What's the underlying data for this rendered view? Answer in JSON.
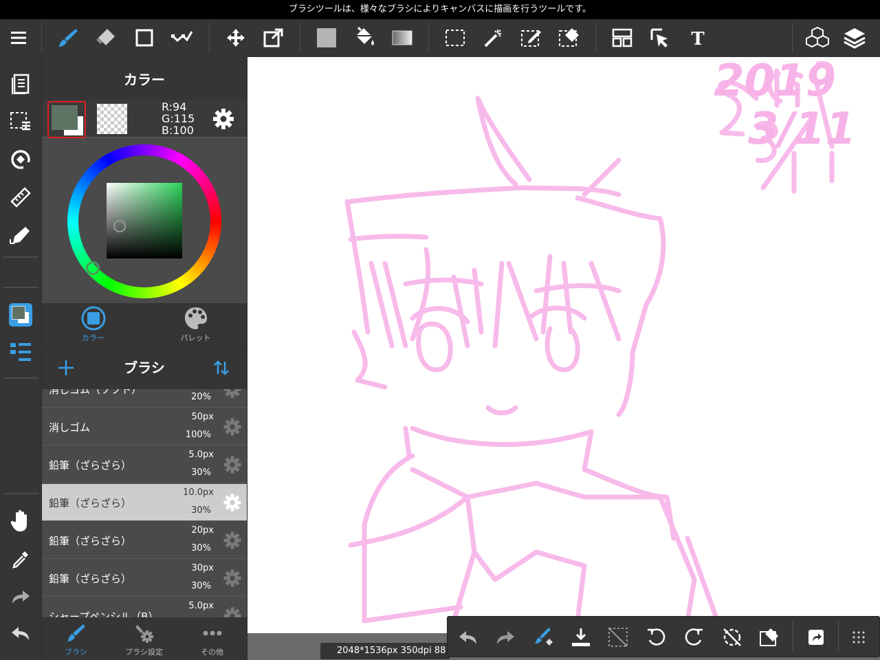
{
  "statusbar": {
    "tooltip": "ブラシツールは、様々なブラシによりキャンバスに描画を行うツールです。"
  },
  "toolbar": {
    "tools": [
      {
        "name": "menu-icon"
      },
      {
        "name": "brush-tool-icon",
        "active": true
      },
      {
        "name": "eraser-tool-icon"
      },
      {
        "name": "rectangle-tool-icon"
      },
      {
        "name": "vector-tool-icon"
      },
      {
        "name": "move-tool-icon"
      },
      {
        "name": "transform-tool-icon"
      },
      {
        "name": "fill-color-icon"
      },
      {
        "name": "bucket-tool-icon"
      },
      {
        "name": "gradient-tool-icon"
      },
      {
        "name": "select-rect-icon"
      },
      {
        "name": "magic-wand-icon"
      },
      {
        "name": "select-pen-icon"
      },
      {
        "name": "select-eraser-icon"
      },
      {
        "name": "frame-divide-icon"
      },
      {
        "name": "operation-tool-icon"
      },
      {
        "name": "text-tool-icon"
      },
      {
        "name": "3d-material-icon"
      },
      {
        "name": "layers-icon"
      }
    ]
  },
  "colorPanel": {
    "title": "カラー",
    "mainColor": "#5e7364",
    "rgb": {
      "r": "R:94",
      "g": "G:115",
      "b": "B:100"
    },
    "tabs": [
      {
        "label": "カラー",
        "active": true
      },
      {
        "label": "パレット",
        "active": false
      }
    ]
  },
  "brushPanel": {
    "title": "ブラシ",
    "brushes": [
      {
        "name": "消しゴム（ソフト）",
        "size": "",
        "opacity": "20%",
        "selected": false
      },
      {
        "name": "消しゴム",
        "size": "50px",
        "opacity": "100%",
        "selected": false
      },
      {
        "name": "鉛筆（ざらざら）",
        "size": "5.0px",
        "opacity": "30%",
        "selected": false
      },
      {
        "name": "鉛筆（ざらざら）",
        "size": "10.0px",
        "opacity": "30%",
        "selected": true
      },
      {
        "name": "鉛筆（ざらざら）",
        "size": "20px",
        "opacity": "30%",
        "selected": false
      },
      {
        "name": "鉛筆（ざらざら）",
        "size": "30px",
        "opacity": "30%",
        "selected": false
      },
      {
        "name": "シャープペンシル（B）",
        "size": "5.0px",
        "opacity": "",
        "selected": false
      }
    ],
    "bottomTabs": [
      {
        "label": "ブラシ",
        "active": true
      },
      {
        "label": "ブラシ設定",
        "active": false
      },
      {
        "label": "その他",
        "active": false
      }
    ]
  },
  "canvas": {
    "info": "2048*1536px 350dpi 88",
    "sketchColor": "#f7b3e8",
    "date_line1": "2019",
    "date_line2": "3/11"
  },
  "accentColor": "#3a9ee4"
}
